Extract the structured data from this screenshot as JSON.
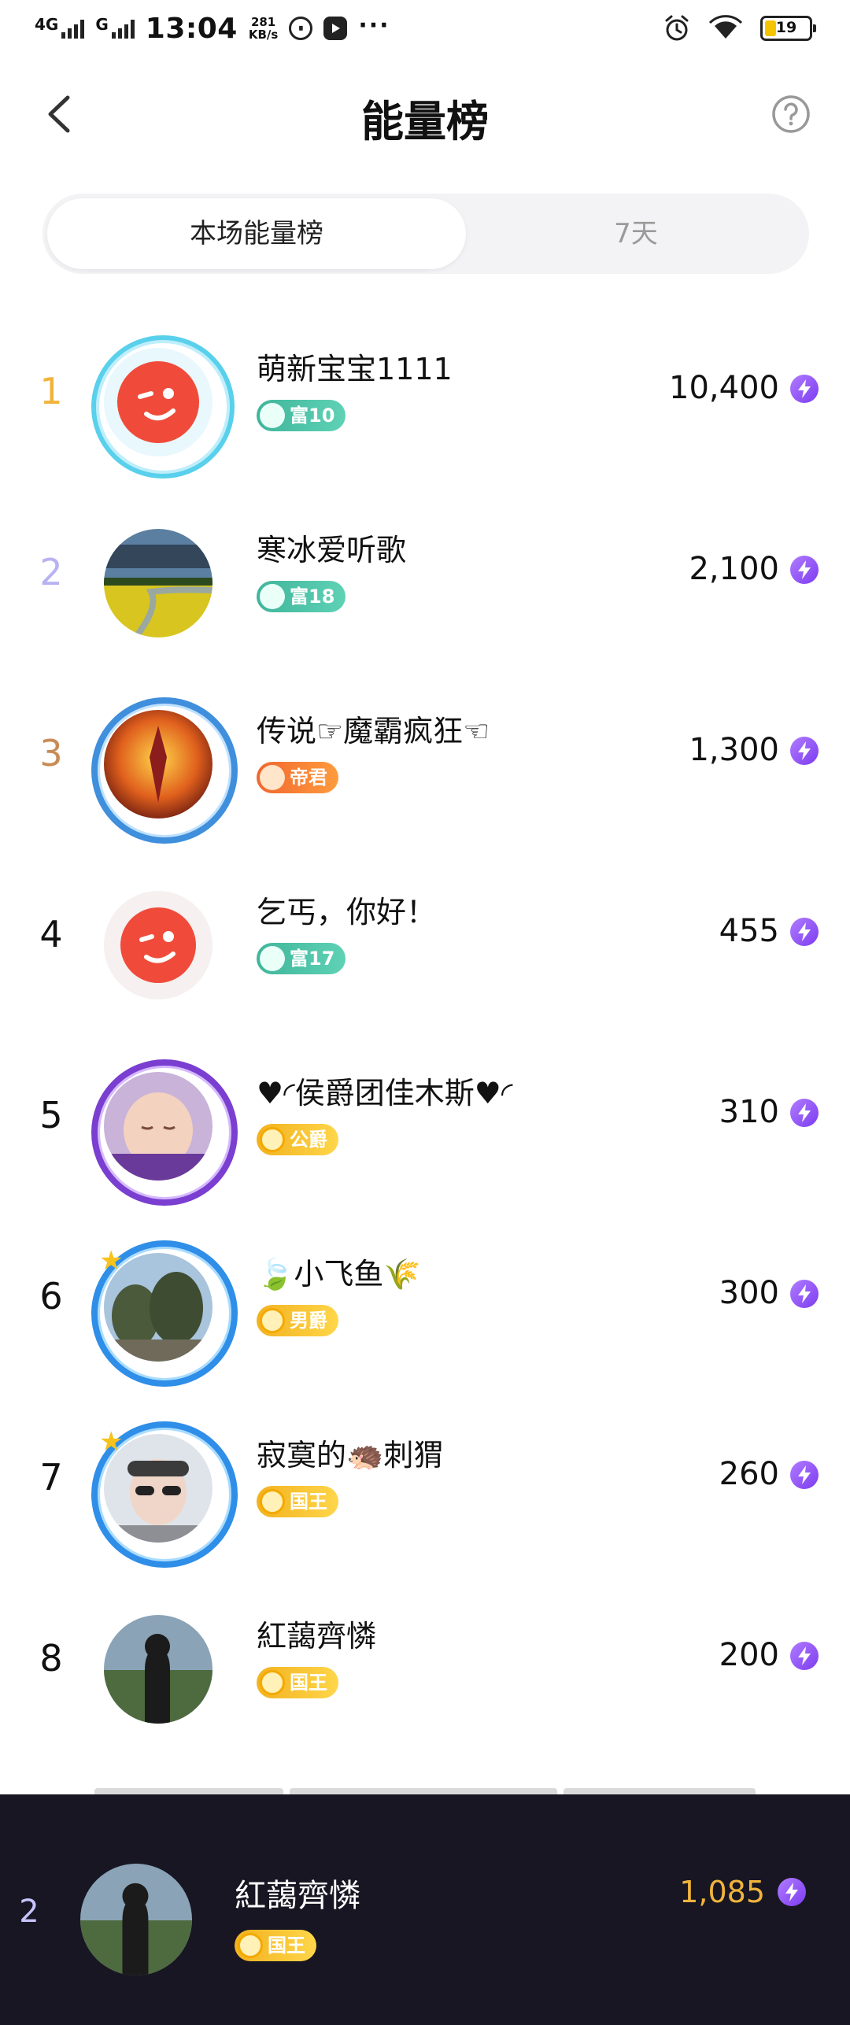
{
  "status_bar": {
    "network": "4G",
    "network2": "G",
    "time": "13:04",
    "speed_value": "281",
    "speed_unit": "KB/s",
    "battery": "19"
  },
  "header": {
    "title": "能量榜",
    "back_icon": "chevron-left-icon",
    "help_icon": "question-circle-icon"
  },
  "tabs": [
    {
      "label": "本场能量榜",
      "active": true
    },
    {
      "label": "7天",
      "active": false
    }
  ],
  "ranking": [
    {
      "rank": "1",
      "name": "萌新宝宝1111",
      "badge": "富10",
      "badge_type": "rich",
      "score": "10,400",
      "rank_color": "#f0b43c"
    },
    {
      "rank": "2",
      "name": "寒冰爱听歌",
      "badge": "富18",
      "badge_type": "rich",
      "score": "2,100",
      "rank_color": "#b8b2f3"
    },
    {
      "rank": "3",
      "name": "传说☞魔霸疯狂☜",
      "badge": "帝君",
      "badge_type": "emp",
      "score": "1,300",
      "rank_color": "#c98b55"
    },
    {
      "rank": "4",
      "name": "乞丐，你好！",
      "badge": "富17",
      "badge_type": "rich",
      "score": "455",
      "rank_color": "#111111"
    },
    {
      "rank": "5",
      "name": "♥◜侯爵团佳木斯♥◜",
      "badge": "公爵",
      "badge_type": "gold",
      "score": "310",
      "rank_color": "#111111"
    },
    {
      "rank": "6",
      "name": "小飞鱼",
      "badge": "男爵",
      "badge_type": "gold",
      "score": "300",
      "rank_color": "#111111"
    },
    {
      "rank": "7",
      "name": "寂寞的🦔刺猬",
      "badge": "国王",
      "badge_type": "gold",
      "score": "260",
      "rank_color": "#111111"
    },
    {
      "rank": "8",
      "name": "紅藹齊憐",
      "badge": "国王",
      "badge_type": "gold",
      "score": "200",
      "rank_color": "#111111"
    }
  ],
  "my_entry": {
    "rank": "2",
    "name": "紅藹齊憐",
    "badge": "国王",
    "score": "1,085"
  },
  "colors": {
    "accent_purple": "#8a4cf5",
    "rich_badge": "#45bfa1",
    "gold_badge": "#f6bd23",
    "emperor_badge": "#f47a35",
    "bottom_bar": "#171622"
  }
}
